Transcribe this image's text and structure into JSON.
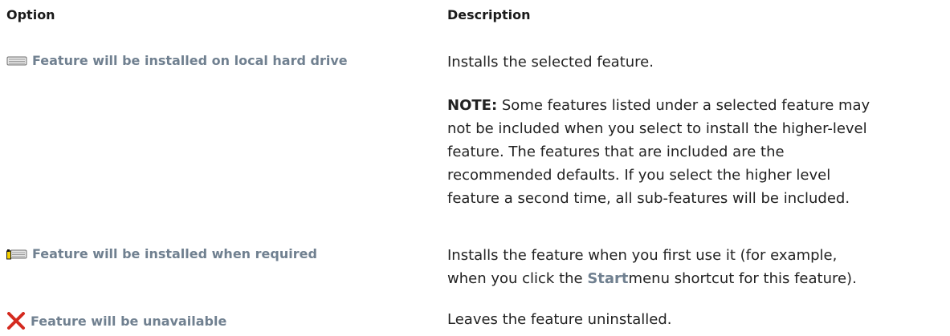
{
  "headers": {
    "option": "Option",
    "description": "Description"
  },
  "rows": [
    {
      "icon": "hard-drive-icon",
      "label": "Feature will be installed on local hard drive",
      "description": "Installs the selected feature.",
      "note_label": "NOTE:",
      "note_lines": [
        "Some features listed under a selected feature may",
        "not be included when you select to install the higher-level",
        "feature. The features that are included are the",
        "recommended defaults. If you select the higher level",
        "feature a second time, all sub-features will be included."
      ]
    },
    {
      "icon": "install-on-demand-icon",
      "label": "Feature will be installed when required",
      "desc_line1": "Installs the feature when you first use it (for example,",
      "desc_line2_prefix": "when you click the ",
      "desc_link": "Start",
      "desc_line2_suffix": "menu shortcut for this feature)."
    },
    {
      "icon": "red-x-icon",
      "label": "Feature will be unavailable",
      "description": "Leaves the feature uninstalled."
    }
  ],
  "colors": {
    "option_text": "#708090",
    "red_x": "#d42a1f"
  }
}
